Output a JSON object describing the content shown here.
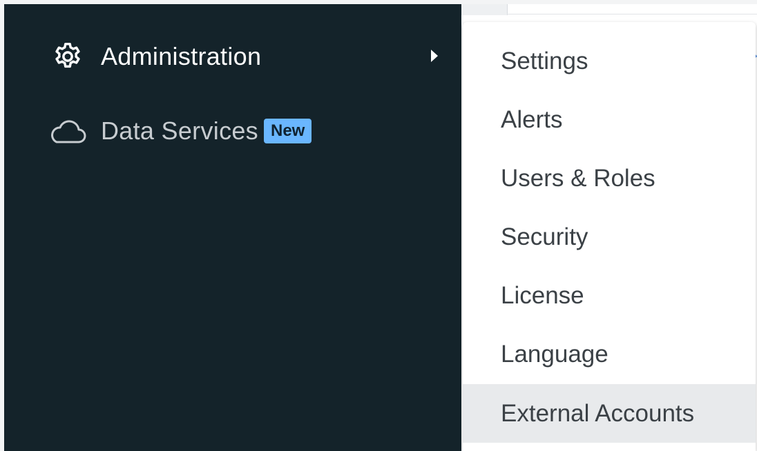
{
  "sidebar": {
    "items": [
      {
        "label": "Administration",
        "icon": "gear-icon",
        "has_submenu": true
      },
      {
        "label": "Data Services",
        "icon": "cloud-icon",
        "badge": "New"
      }
    ]
  },
  "submenu": {
    "items": [
      {
        "label": "Settings"
      },
      {
        "label": "Alerts"
      },
      {
        "label": "Users & Roles"
      },
      {
        "label": "Security"
      },
      {
        "label": "License"
      },
      {
        "label": "Language"
      },
      {
        "label": "External Accounts",
        "highlighted": true
      }
    ]
  },
  "colors": {
    "sidebar_bg": "#14232a",
    "badge_bg": "#6ab6ff",
    "menu_text": "#3b4146",
    "highlight_bg": "#e8eaec"
  }
}
